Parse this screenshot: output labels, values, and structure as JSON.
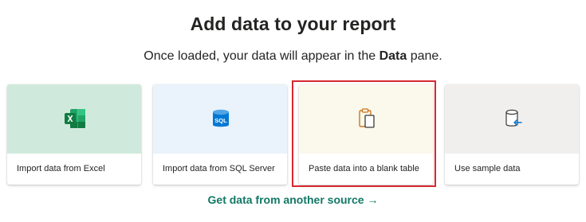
{
  "heading": {
    "title": "Add data to your report",
    "subtitle_prefix": "Once loaded, your data will appear in the ",
    "subtitle_bold": "Data",
    "subtitle_suffix": " pane."
  },
  "cards": [
    {
      "label": "Import data from Excel",
      "icon": "excel-icon",
      "bg": "#cfeadc"
    },
    {
      "label": "Import data from SQL Server",
      "icon": "sql-database-icon",
      "icon_text": "SQL",
      "bg": "#eaf3fb"
    },
    {
      "label": "Paste data into a blank table",
      "icon": "clipboard-paste-icon",
      "bg": "#fbf8ec",
      "selected": true
    },
    {
      "label": "Use sample data",
      "icon": "sample-data-cylinder-icon",
      "bg": "#f0efee"
    }
  ],
  "more_link": {
    "label": "Get data from another source →"
  },
  "colors": {
    "accent": "#117865",
    "highlight": "#d7282f",
    "excel_green": "#107c41",
    "sql_blue": "#0078d4",
    "paste_orange": "#c9761b"
  }
}
